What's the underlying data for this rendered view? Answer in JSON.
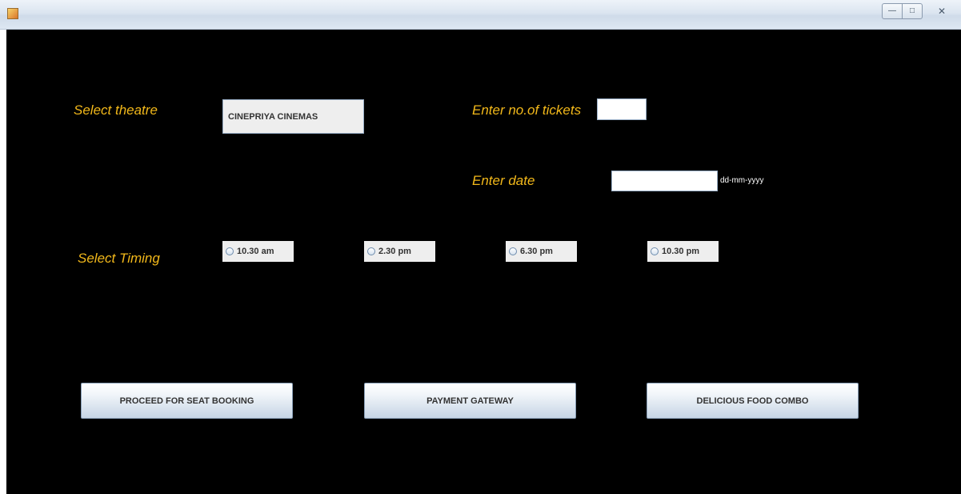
{
  "window": {
    "title": "",
    "controls": {
      "minimize": "—",
      "maximize": "□",
      "close": "✕"
    }
  },
  "form": {
    "theatre_label": "Select theatre",
    "theatre_value": "CINEPRIYA CINEMAS",
    "tickets_label": "Enter no.of tickets",
    "tickets_value": "",
    "date_label": "Enter date",
    "date_value": "",
    "date_hint": "dd-mm-yyyy",
    "timing_label": "Select Timing",
    "timings": [
      "10.30 am",
      "2.30 pm",
      "6.30 pm",
      "10.30 pm"
    ]
  },
  "actions": {
    "seat_booking": "PROCEED FOR SEAT BOOKING",
    "payment": "PAYMENT GATEWAY",
    "food_combo": "DELICIOUS FOOD COMBO"
  }
}
